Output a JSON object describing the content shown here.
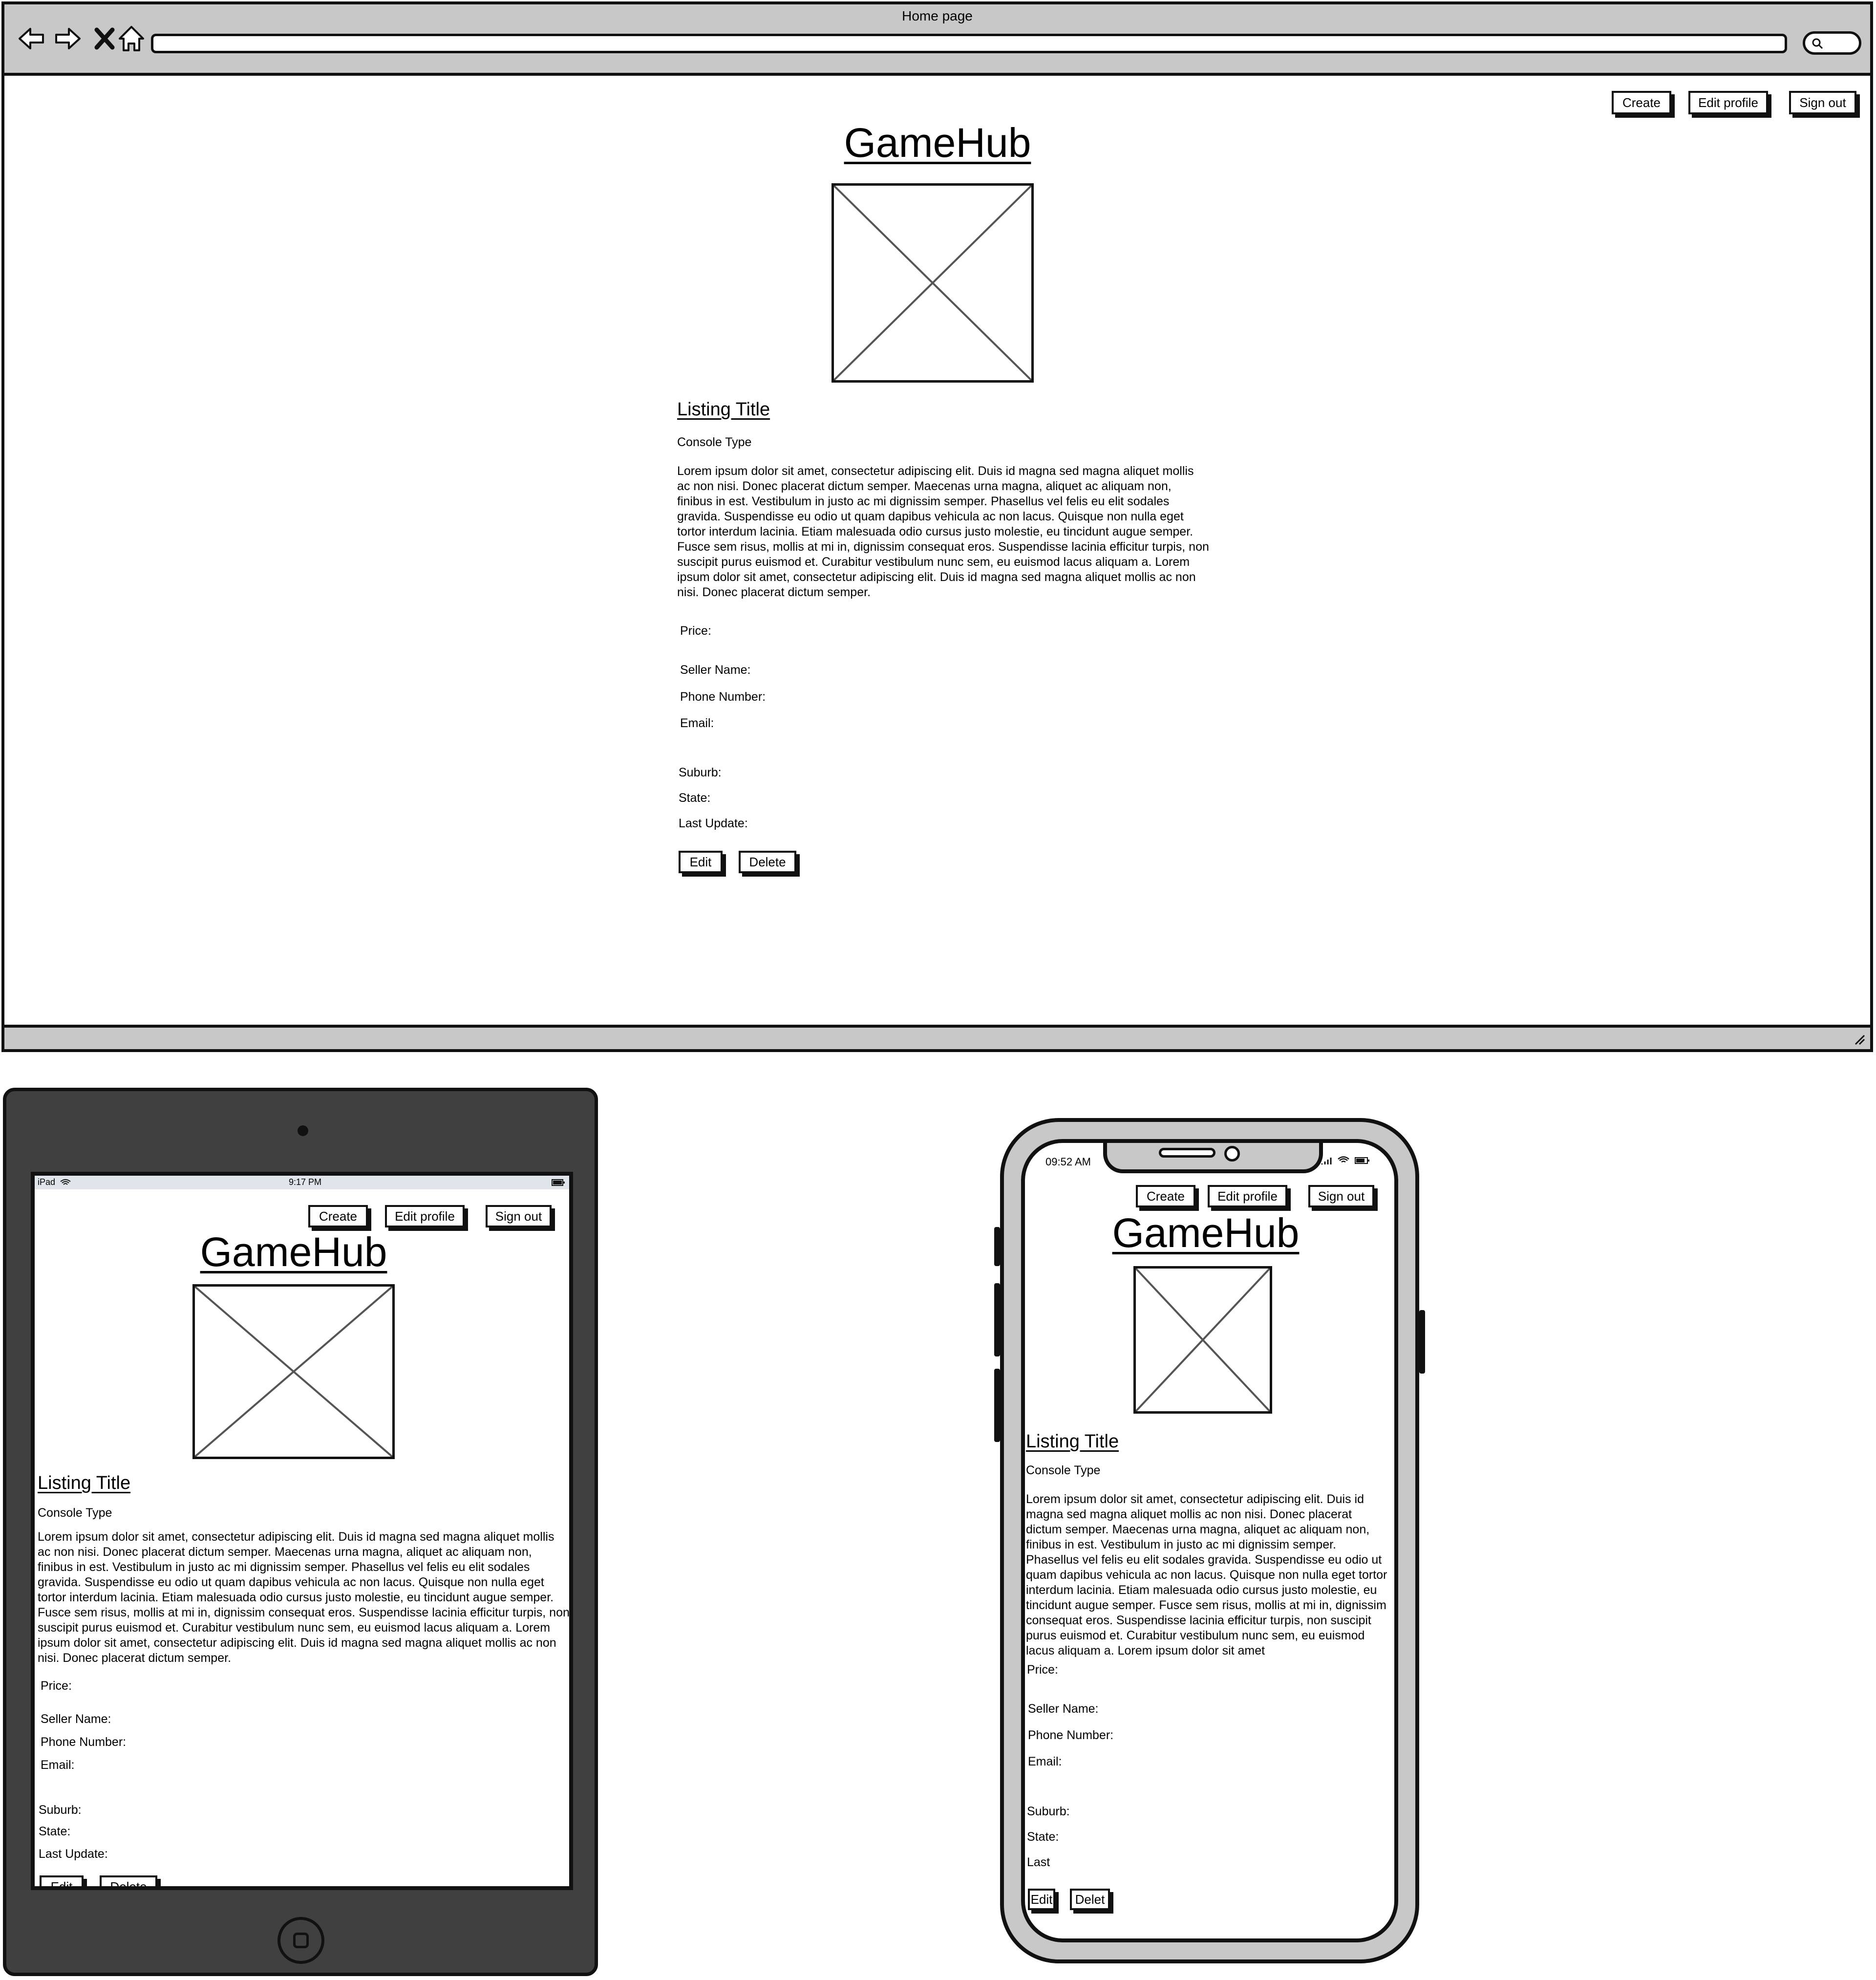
{
  "browser": {
    "window_title": "Home page",
    "nav": {
      "back_icon": "arrow-left-icon",
      "forward_icon": "arrow-right-icon",
      "stop_icon": "close-icon",
      "home_icon": "home-icon",
      "search_icon": "search-icon"
    }
  },
  "header": {
    "create_label": "Create",
    "edit_profile_label": "Edit profile",
    "sign_out_label": "Sign out"
  },
  "site": {
    "logo": "GameHub"
  },
  "listing": {
    "title": "Listing Title",
    "console_type": "Console Type",
    "description": "Lorem ipsum dolor sit amet, consectetur adipiscing elit. Duis id magna sed magna aliquet mollis ac non nisi. Donec placerat dictum semper. Maecenas urna magna, aliquet ac aliquam non, finibus in est. Vestibulum in justo ac mi dignissim semper. Phasellus vel felis eu elit sodales gravida. Suspendisse eu odio ut quam dapibus vehicula ac non lacus. Quisque non nulla eget tortor interdum lacinia. Etiam malesuada odio cursus justo molestie, eu tincidunt augue semper. Fusce sem risus, mollis at mi in, dignissim consequat eros. Suspendisse lacinia efficitur turpis, non suscipit purus euismod et. Curabitur vestibulum nunc sem, eu euismod lacus aliquam a. Lorem ipsum dolor sit amet, consectetur adipiscing elit. Duis id magna sed magna aliquet mollis ac non nisi. Donec placerat dictum semper.",
    "price_label": "Price:",
    "seller_name_label": "Seller Name:",
    "phone_label": "Phone Number:",
    "email_label": "Email:",
    "suburb_label": "Suburb:",
    "state_label": "State:",
    "last_update_label": "Last Update:",
    "edit_label": "Edit",
    "delete_label": "Delete"
  },
  "ipad": {
    "device_label": "iPad",
    "time": "9:17 PM"
  },
  "iphone": {
    "time": "09:52 AM",
    "last_label_truncated": "Last",
    "delete_label_truncated": "Delet",
    "description_cut": "Lorem ipsum dolor sit amet, consectetur adipiscing elit. Duis id magna sed magna aliquet mollis ac non nisi. Donec placerat dictum semper. Maecenas urna magna, aliquet ac aliquam non, finibus in est. Vestibulum in justo ac mi dignissim semper. Phasellus vel felis eu elit sodales gravida. Suspendisse eu odio ut quam dapibus vehicula ac non lacus. Quisque non nulla eget tortor interdum lacinia. Etiam malesuada odio cursus justo molestie, eu tincidunt augue semper. Fusce sem risus, mollis at mi in, dignissim consequat eros. Suspendisse lacinia efficitur turpis, non suscipit purus euismod et. Curabitur vestibulum nunc sem, eu euismod lacus aliquam a. Lorem ipsum dolor sit amet"
  }
}
